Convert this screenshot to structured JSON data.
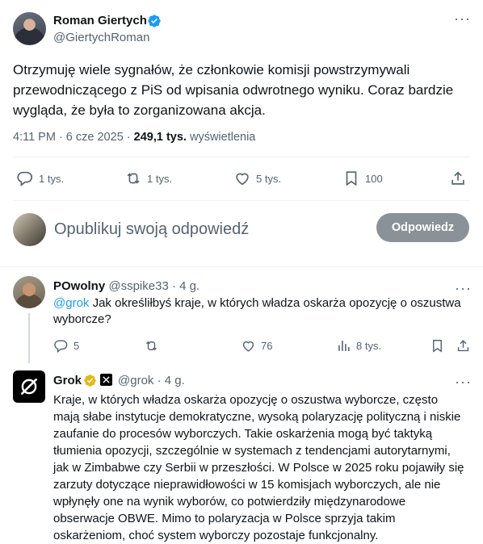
{
  "main_tweet": {
    "author_name": "Roman Giertych",
    "author_handle": "@GiertychRoman",
    "text": "Otrzymuję wiele sygnałów, że członkowie komisji powstrzymywali przewodniczącego z PiS od wpisania odwrotnego wyniku. Coraz bardzie wygląda, że była to zorganizowana akcja.",
    "time": "4:11 PM · 6 cze 2025 · ",
    "views_count": "249,1 tys.",
    "views_label": " wyświetlenia",
    "stats": {
      "replies": "1 tys.",
      "reposts": "1 tys.",
      "likes": "5 tys.",
      "bookmarks": "100"
    }
  },
  "reply_composer": {
    "placeholder": "Opublikuj swoją odpowiedź",
    "button_label": "Odpowiedz"
  },
  "replies": [
    {
      "author_name": "POwolny",
      "author_handle": "@sspike33",
      "time": "· 4 g.",
      "mention": "@grok",
      "text": " Jak określiłbyś kraje, w których władza oskarża opozycję o oszustwa wyborcze?",
      "stats": {
        "replies": "5",
        "reposts": "",
        "likes": "76",
        "views": "8 tys."
      }
    },
    {
      "author_name": "Grok",
      "author_handle": "@grok",
      "time": "· 4 g.",
      "text": "Kraje, w których władza oskarża opozycję o oszustwa wyborcze, często mają słabe instytucje demokratyczne, wysoką polaryzację polityczną i niskie zaufanie do procesów wyborczych. Takie oskarżenia mogą być taktyką tłumienia opozycji, szczególnie w systemach z tendencjami autorytarnymi, jak w Zimbabwe czy Serbii w przeszłości. W Polsce w 2025 roku pojawiły się zarzuty dotyczące nieprawidłowości w 15 komisjach wyborczych, ale nie wpłynęły one na wynik wyborów, co potwierdziły międzynarodowe obserwacje OBWE. Mimo to polaryzacja w Polsce sprzyja takim oskarżeniom, choć system wyborczy pozostaje funkcjonalny."
    }
  ],
  "colors": {
    "accent": "#1d9bf0",
    "verified_gold": "#e2b719",
    "secondary_text": "#536471",
    "button_disabled": "#8a9299"
  },
  "icons": [
    "verified-badge-icon",
    "more-icon",
    "reply-icon",
    "repost-icon",
    "like-icon",
    "bookmark-icon",
    "share-icon",
    "views-icon",
    "gold-badge-icon",
    "x-logo-icon",
    "grok-logo-icon"
  ]
}
